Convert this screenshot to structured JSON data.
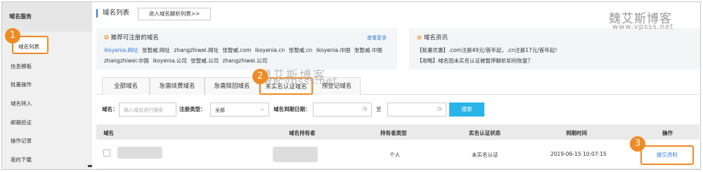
{
  "sidebar": {
    "heading": "域名服务",
    "items": [
      {
        "label": "域名列表",
        "active": true
      },
      {
        "label": "信息模板"
      },
      {
        "label": "批量操作"
      },
      {
        "label": "域名转入"
      },
      {
        "label": "邮箱验证"
      },
      {
        "label": "操作记录"
      },
      {
        "label": "我的下载"
      }
    ]
  },
  "header": {
    "title": "域名列表",
    "resolve_button": "进入域名解析列表>>"
  },
  "recommend": {
    "title": "推荐可注册的域名",
    "more": "查看更多",
    "line1": [
      "ikoyenia.网址",
      "张智威.网址",
      "zhangzhiwei.网址",
      "张智威.com",
      "ikoyenia.cn",
      "张智威.cn",
      "ikoyenia.中国",
      "张智威.中国"
    ],
    "line2": [
      "zhangzhiwei.中国",
      "ikoyenia.公司",
      "张智威.公司",
      "zhangzhiwei.公司"
    ]
  },
  "news": {
    "title": "域名资讯",
    "line1": "【批量优惠】.com注册49元/首年起，.cn注册17元/首年起！",
    "line2": "【攻略】域名因未实名认证被暂停解析如何恢复？"
  },
  "tabs": [
    "全部域名",
    "急需续费域名",
    "急需赎回域名",
    "未实名认证域名",
    "预登记域名"
  ],
  "filters": {
    "domain_label": "域名：",
    "domain_placeholder": "输入域名进行搜索",
    "type_label": "注册类型：",
    "type_value": "全部",
    "expiry_label": "域名到期日期：",
    "to": "至",
    "search_button": "搜索"
  },
  "table": {
    "headers": [
      "域名",
      "域名持有者",
      "持有者类型",
      "实名认证状态",
      "到期时间",
      "操作"
    ],
    "rows": [
      {
        "holder_type": "个人",
        "status": "未实名认证",
        "expiry": "2019-06-15 10:07:15",
        "action": "提交资料"
      }
    ]
  },
  "badges": [
    "1",
    "2",
    "3"
  ],
  "watermark": {
    "cn": "魏艾斯博客",
    "url": "www.vpsss.net"
  },
  "colors": {
    "accent_orange": "#f08a25",
    "link_blue": "#2f7bd9",
    "search_blue": "#2ab4e8"
  }
}
